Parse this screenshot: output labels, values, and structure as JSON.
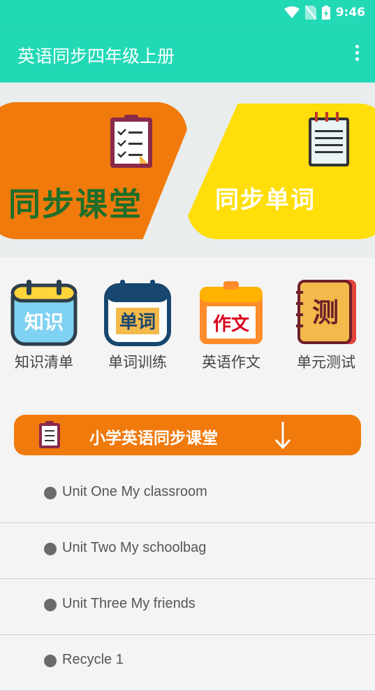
{
  "status_bar": {
    "time": "9:46"
  },
  "app_bar": {
    "title": "英语同步四年级上册"
  },
  "banner": {
    "left_label": "同步课堂",
    "right_label": "同步单词",
    "left_color": "#f07a0c",
    "right_color": "#ffde0a"
  },
  "menu": {
    "items": [
      {
        "label": "知识清单",
        "icon_text": "知识",
        "icon": "calendar-knowledge-icon"
      },
      {
        "label": "单词训练",
        "icon_text": "单词",
        "icon": "calendar-words-icon"
      },
      {
        "label": "英语作文",
        "icon_text": "作文",
        "icon": "calendar-essay-icon"
      },
      {
        "label": "单元测试",
        "icon_text": "测",
        "icon": "book-test-icon"
      }
    ]
  },
  "section": {
    "title": "小学英语同步课堂"
  },
  "units": [
    {
      "label": "Unit One My classroom"
    },
    {
      "label": "Unit Two My schoolbag"
    },
    {
      "label": "Unit Three My friends"
    },
    {
      "label": "Recycle 1"
    }
  ],
  "colors": {
    "primary": "#22d9b6",
    "accent_orange": "#f07a0c",
    "accent_yellow": "#ffde0a"
  }
}
